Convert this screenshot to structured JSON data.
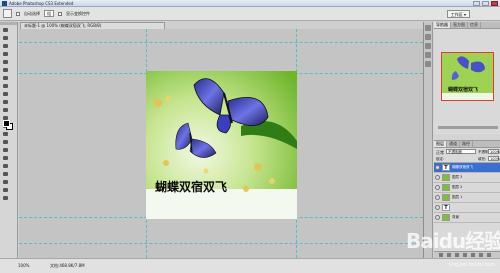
{
  "titlebar": {
    "menu": [
      "Adobe Photoshop CS3 Extended",
      "文件(F)",
      "编辑(E)",
      "图像(I)",
      "图层(L)",
      "选择(S)",
      "滤镜(T)",
      "分析(A)",
      "视图(V)",
      "窗口(W)",
      "帮助(H)"
    ]
  },
  "options": {
    "auto_select": "自动选择",
    "group": "组",
    "show_transform": "显示变换控件",
    "workspace": "工作区 ▾"
  },
  "document": {
    "tab": "未标题-1 @ 100% (蝴蝶双宿双飞, RGB/8)"
  },
  "artwork": {
    "caption": "蝴蝶双宿双飞",
    "background": "#8fcb3d",
    "butterfly_color": "#5b5fd8"
  },
  "navigator": {
    "tabs": [
      "导航器",
      "直方图",
      "信息"
    ],
    "caption": "蝴蝶双宿双飞"
  },
  "layers": {
    "tabs": [
      "图层",
      "通道",
      "路径"
    ],
    "mode": "正常",
    "blend_select": "不透明度",
    "opacity_label": "不透明度:",
    "opacity": "100%",
    "lock_label": "锁定:",
    "fill_label": "填充:",
    "fill": "100%",
    "items": [
      {
        "name": "蝴蝶双宿双飞",
        "kind": "text"
      },
      {
        "name": "图层 3",
        "kind": "image"
      },
      {
        "name": "图层 2",
        "kind": "image"
      },
      {
        "name": "图层 1",
        "kind": "image"
      },
      {
        "name": "T",
        "kind": "text"
      },
      {
        "name": "背景",
        "kind": "image"
      }
    ]
  },
  "status": {
    "zoom": "100%",
    "doc_size": "文档:468.8K/7.8M"
  },
  "watermark": {
    "text": "Baidu经验",
    "sub": "jingyan.baidu.com"
  }
}
